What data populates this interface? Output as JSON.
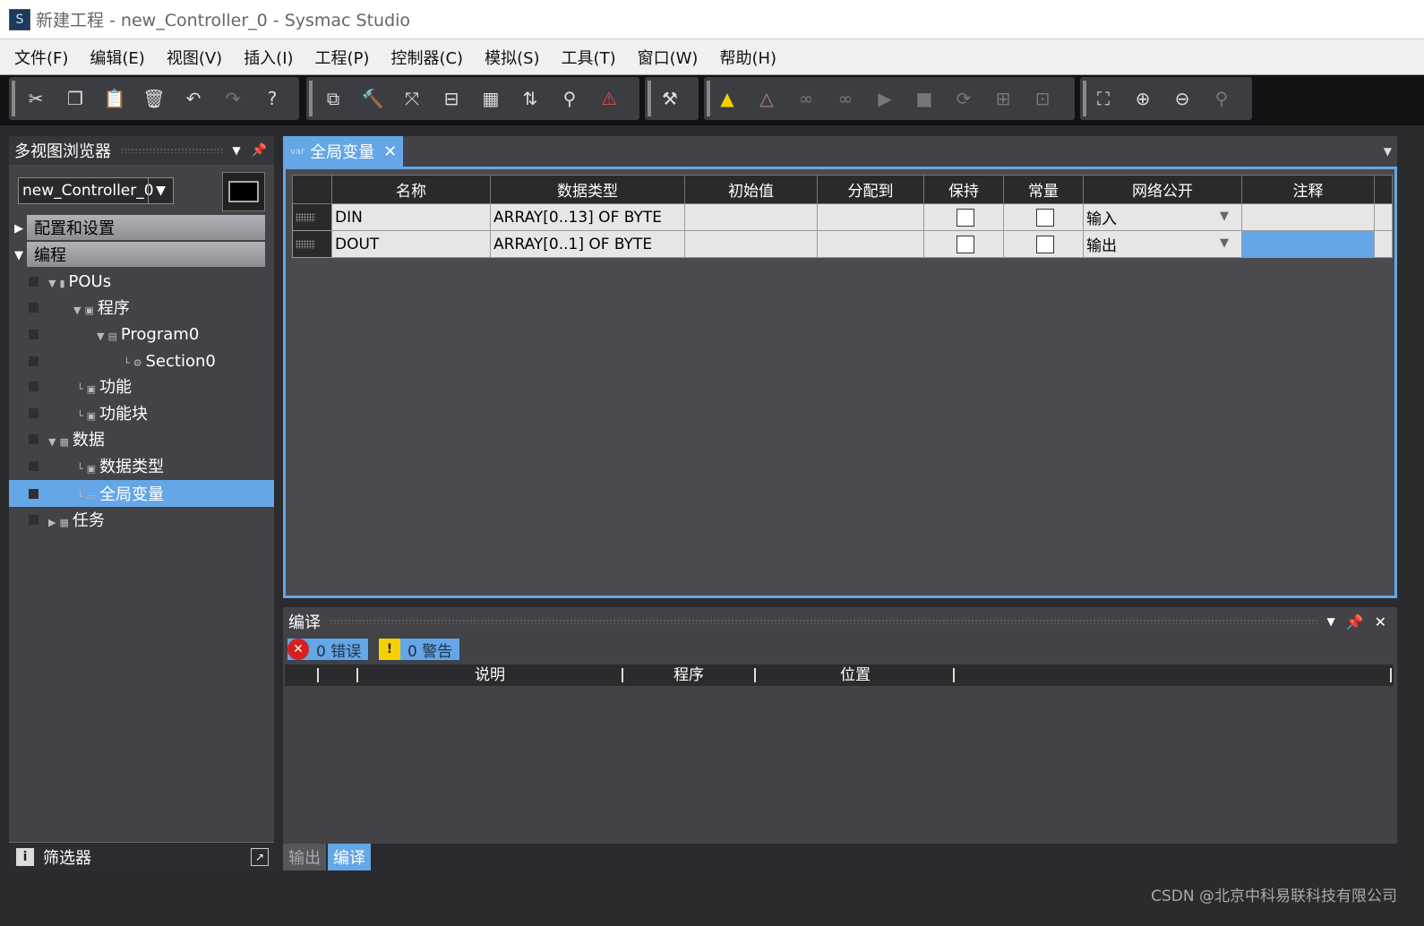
{
  "window": {
    "title": "新建工程 - new_Controller_0 - Sysmac Studio"
  },
  "menu": [
    "文件(F)",
    "编辑(E)",
    "视图(V)",
    "插入(I)",
    "工程(P)",
    "控制器(C)",
    "模拟(S)",
    "工具(T)",
    "窗口(W)",
    "帮助(H)"
  ],
  "toolbar": {
    "groups": [
      [
        "cut-icon",
        "copy-icon",
        "paste-icon",
        "delete-icon",
        "undo-icon",
        "redo-icon",
        "help-icon"
      ],
      [
        "cross-reference-icon",
        "build-icon",
        "rebuild-icon",
        "compare-icon",
        "table-icon",
        "transfer-icon",
        "search-icon",
        "error-icon"
      ],
      [
        "online-icon"
      ],
      [
        "warning-icon",
        "warning-off-icon",
        "watch-icon",
        "watch-off-icon",
        "step-icon",
        "stop-icon",
        "refresh-icon",
        "synchronize-icon",
        "network-icon"
      ],
      [
        "fit-icon",
        "zoom-in-icon",
        "zoom-out-icon",
        "zoom-reset-icon"
      ]
    ]
  },
  "left_panel": {
    "title": "多视图浏览器",
    "controller": "new_Controller_0",
    "sections": [
      "配置和设置",
      "编程"
    ],
    "tree": [
      {
        "label": "POUs"
      },
      {
        "label": "程序"
      },
      {
        "label": "Program0"
      },
      {
        "label": "Section0"
      },
      {
        "label": "功能"
      },
      {
        "label": "功能块"
      },
      {
        "label": "数据"
      },
      {
        "label": "数据类型"
      },
      {
        "label": "全局变量"
      },
      {
        "label": "任务"
      }
    ],
    "filter": "筛选器"
  },
  "editor": {
    "tab_label": "全局变量",
    "tab_icon": "var",
    "columns": [
      "名称",
      "数据类型",
      "初始值",
      "分配到",
      "保持",
      "常量",
      "网络公开",
      "注释"
    ],
    "rows": [
      {
        "name": "DIN",
        "type": "ARRAY[0..13] OF BYTE",
        "init": "",
        "assign": "",
        "retain": false,
        "constant": false,
        "network": "输入",
        "comment": ""
      },
      {
        "name": "DOUT",
        "type": "ARRAY[0..1] OF BYTE",
        "init": "",
        "assign": "",
        "retain": false,
        "constant": false,
        "network": "输出",
        "comment": ""
      }
    ]
  },
  "compile": {
    "title": "编译",
    "errors": "0 错误",
    "warnings": "0 警告",
    "columns": [
      "说明",
      "程序",
      "位置"
    ],
    "tabs": [
      "输出",
      "编译"
    ]
  },
  "status": {
    "watermark": "CSDN @北京中科易联科技有限公司"
  },
  "colors": {
    "accent": "#64a6e6",
    "panel": "#424247",
    "header": "#2a2a2c"
  }
}
